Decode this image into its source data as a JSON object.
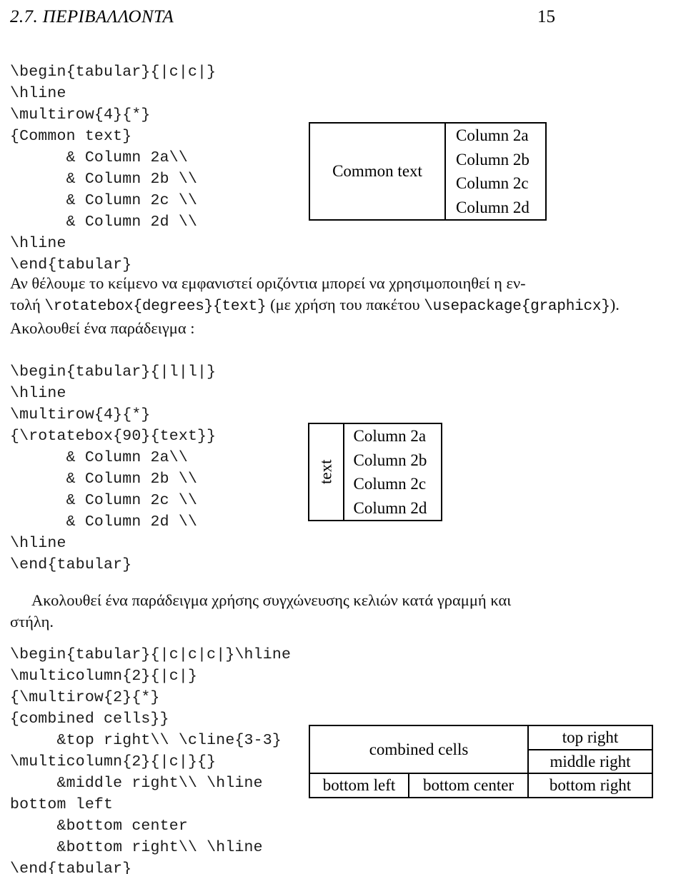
{
  "header": {
    "title": "2.7.  ΠΕΡΙΒΑΛΛΟΝΤΑ",
    "page_number": "15"
  },
  "code_blocks": {
    "multirow": "\\begin{tabular}{|c|c|}\n\\hline\n\\multirow{4}{*}\n{Common text}\n      & Column 2a\\\\\n      & Column 2b \\\\\n      & Column 2c \\\\\n      & Column 2d \\\\\n\\hline\n\\end{tabular}",
    "rotatebox": "\\begin{tabular}{|l|l|}\n\\hline\n\\multirow{4}{*}\n{\\rotatebox{90}{text}}\n      & Column 2a\\\\\n      & Column 2b \\\\\n      & Column 2c \\\\\n      & Column 2d \\\\\n\\hline\n\\end{tabular}",
    "combined": "\\begin{tabular}{|c|c|c|}\\hline\n\\multicolumn{2}{|c|}\n{\\multirow{2}{*}\n{combined cells}}\n     &top right\\\\ \\cline{3-3}\n\\multicolumn{2}{|c|}{}\n     &middle right\\\\ \\hline\nbottom left\n     &bottom center\n     &bottom right\\\\ \\hline\n\\end{tabular}"
  },
  "paragraphs": {
    "rotatebox_intro": {
      "line1": "Αν θέλουμε το κείμενο να εμφανιστεί οριζόντια μπορεί να χρησιμοποιηθεί η εν-",
      "line2_pre": "τολή ",
      "line2_code1": "\\rotatebox{degrees}{text}",
      "line2_mid": " (με χρήση του πακέτου ",
      "line2_code2": "\\usepackage{graphicx}",
      "line2_post": ").",
      "line3": "Ακολουθεί ένα παράδειγμα :"
    },
    "merge_intro": {
      "line1": "Ακολουθεί ένα παράδειγμα χρήσης συγχώνευσης κελιών κατά γραμμή και",
      "line2": "στήλη."
    }
  },
  "tables": {
    "multirow": {
      "common_cell": "Common text",
      "rows": [
        "Column 2a",
        "Column 2b",
        "Column 2c",
        "Column 2d"
      ]
    },
    "rotatebox": {
      "rotated_cell": "text",
      "rows": [
        "Column 2a",
        "Column 2b",
        "Column 2c",
        "Column 2d"
      ]
    },
    "combined": {
      "combined_cell": "combined cells",
      "top_right": "top right",
      "middle_right": "middle right",
      "bottom_left": "bottom left",
      "bottom_center": "bottom center",
      "bottom_right": "bottom right"
    }
  }
}
